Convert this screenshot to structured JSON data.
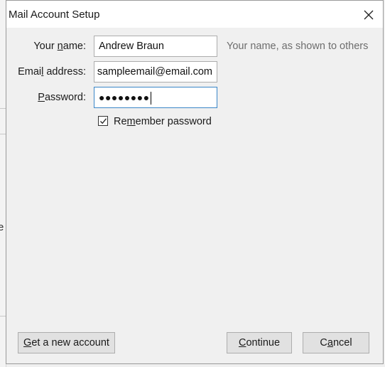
{
  "background": {
    "edge_text": "e"
  },
  "dialog": {
    "title": "Mail Account Setup"
  },
  "form": {
    "name": {
      "label_pre": "Your ",
      "label_key": "n",
      "label_post": "ame:",
      "value": "Andrew Braun",
      "hint": "Your name, as shown to others"
    },
    "email": {
      "label_pre": "Emai",
      "label_key": "l",
      "label_post": " address:",
      "value": "sampleemail@email.com"
    },
    "password": {
      "label_pre": "",
      "label_key": "P",
      "label_post": "assword:",
      "masked_value": "●●●●●●●●"
    },
    "remember": {
      "label_pre": "Re",
      "label_key": "m",
      "label_post": "ember password",
      "checked": true
    }
  },
  "buttons": {
    "new_account": {
      "pre": "",
      "key": "G",
      "post": "et a new account"
    },
    "continue": {
      "pre": "",
      "key": "C",
      "post": "ontinue"
    },
    "cancel": {
      "pre": "C",
      "key": "a",
      "post": "ncel"
    }
  }
}
